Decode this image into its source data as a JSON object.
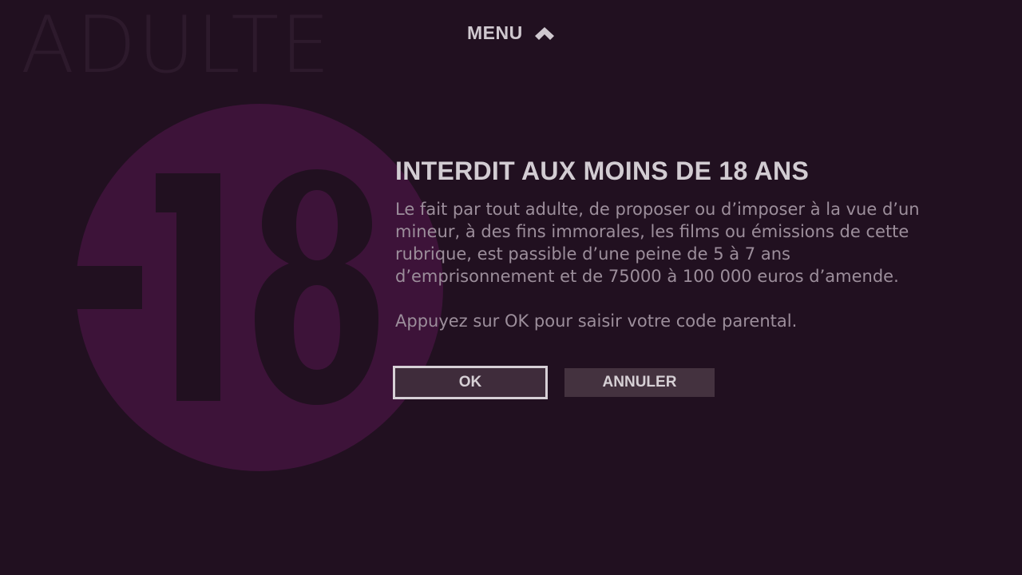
{
  "section": {
    "watermark": "ADULTE"
  },
  "menu": {
    "label": "MENU",
    "icon": "chevron-up-icon"
  },
  "rating": {
    "badge_text": "-18",
    "badge_color": "#3d1339"
  },
  "dialog": {
    "title": "INTERDIT AUX MOINS DE 18 ANS",
    "body": "Le fait par tout adulte, de proposer ou d’imposer à la vue d’un mineur, à des fins immorales, les films ou émissions de cette rubrique, est passible d’une peine de 5 à 7 ans d’emprisonnement et de 75000 à 100 000 euros d’amende.",
    "instruction": "Appuyez sur OK pour saisir votre code parental.",
    "buttons": {
      "ok_label": "OK",
      "cancel_label": "ANNULER"
    },
    "focused_button": "OK"
  },
  "colors": {
    "background": "#211020",
    "button_bg": "#44323f",
    "focus_border": "#d7d0d6"
  }
}
